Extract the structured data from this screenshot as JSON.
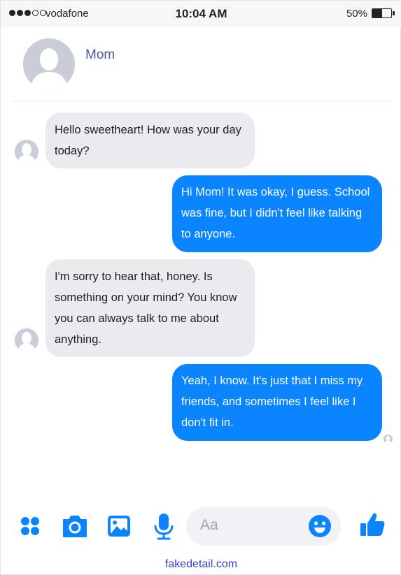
{
  "status_bar": {
    "carrier": "vodafone",
    "time": "10:04 AM",
    "battery_percent": "50%",
    "battery_level": 0.5,
    "signal_bars_filled": 3,
    "signal_bars_total": 5
  },
  "header": {
    "contact_name": "Mom"
  },
  "messages": [
    {
      "direction": "incoming",
      "text": "Hello sweetheart! How was your day today?"
    },
    {
      "direction": "outgoing",
      "text": "Hi Mom! It was okay, I guess. School was fine, but I didn't feel like talking to anyone."
    },
    {
      "direction": "incoming",
      "text": "I'm sorry to hear that, honey. Is something on your mind? You know you can always talk to me about anything."
    },
    {
      "direction": "outgoing",
      "text": "Yeah, I know. It's just that I miss my friends, and sometimes I feel like I don't fit in."
    }
  ],
  "composer": {
    "placeholder": "Aa",
    "icons": [
      "apps-icon",
      "camera-icon",
      "image-icon",
      "microphone-icon",
      "emoji-icon",
      "thumbs-up-icon"
    ]
  },
  "footer": {
    "text": "fakedetail.com"
  },
  "colors": {
    "accent": "#0a84ff",
    "incoming_bubble": "#e9ebee",
    "contact_name": "#4a5b9c",
    "footer_link": "#3b3fc9"
  }
}
